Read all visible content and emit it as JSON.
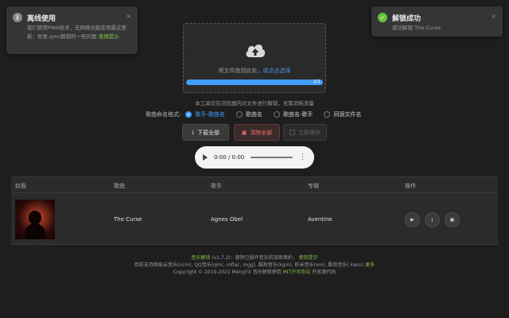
{
  "notifications": {
    "offline": {
      "title": "离线使用",
      "body": "我们使用PWA技术，无网络也能使用最近更新：修复.qmc解锁的一些问题",
      "link": "使用提示",
      "close": "×"
    },
    "unlock": {
      "title": "解锁成功",
      "body": "成功解锁 The Curse",
      "close": "×"
    }
  },
  "dropzone": {
    "hint_prefix": "将文件拖到此处，",
    "hint_link": "或点击选择",
    "progress_text": "1/1",
    "progress_fraction": 1.0
  },
  "tool_note": "本工具仅在浏览器内对文件进行解锁，无需消耗流量",
  "naming": {
    "label": "歌曲命名格式:",
    "options": [
      "歌手-歌曲名",
      "歌曲名",
      "歌曲名-歌手",
      "同源文件名"
    ],
    "selected": 0
  },
  "buttons": {
    "download_all": "下载全部",
    "clear_all": "清除全部",
    "save_now": "立即保存"
  },
  "player": {
    "time": "0:00 / 0:00"
  },
  "table": {
    "headers": {
      "cover": "封面",
      "title": "歌曲",
      "artist": "歌手",
      "album": "专辑",
      "actions": "操作"
    },
    "rows": [
      {
        "title": "The Curse",
        "artist": "Agnes Obel",
        "album": "Aventine"
      }
    ]
  },
  "footer": {
    "line1_app": "音乐解锁",
    "line1_version": "(v1.7.2)：移除已损坏音乐的加密保护。",
    "line1_link": "使用提示",
    "line2": "目前支持网易云音乐(ncm), QQ音乐(qmc, mflac, mgg), 酷狗音乐(kgm), 虾米音乐(xm), 酷我音乐(.kwm)",
    "line2_link": "更多",
    "line3_prefix": "Copyright © 2019-2021 MengYX 音乐解锁使用",
    "line3_link": "MIT许可协议",
    "line3_suffix": "开放源代码"
  },
  "colors": {
    "accent": "#409eff",
    "success": "#67c23a",
    "danger": "#f56c6c",
    "link_green": "#7fc24a"
  }
}
